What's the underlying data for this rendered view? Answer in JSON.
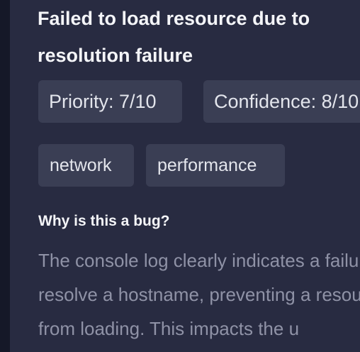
{
  "bug": {
    "title": "Failed to load resource due to resolution failure",
    "priority_label": "Priority: 7/10",
    "confidence_label": "Confidence: 8/10",
    "tags": [
      "network",
      "performance"
    ],
    "section_heading": "Why is this a bug?",
    "description": "The console log clearly indicates a failure to resolve a hostname, preventing a resource from loading. This impacts the u"
  }
}
